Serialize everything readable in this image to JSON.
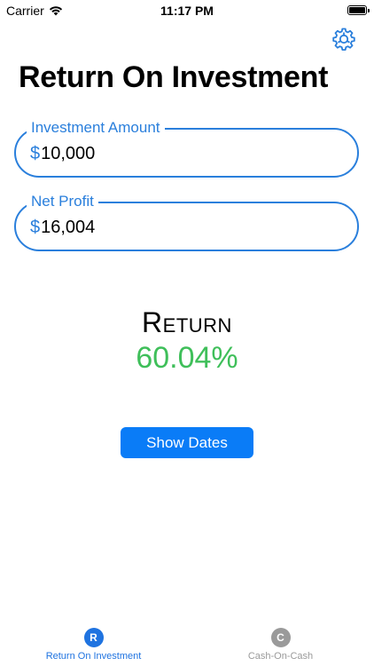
{
  "status_bar": {
    "carrier": "Carrier",
    "time": "11:17 PM"
  },
  "header": {
    "title": "Return On Investment",
    "settings_icon": "gear-icon"
  },
  "fields": {
    "investment_amount": {
      "label": "Investment Amount",
      "currency": "$",
      "value": "10,000"
    },
    "net_profit": {
      "label": "Net Profit",
      "currency": "$",
      "value": "16,004"
    }
  },
  "result": {
    "label": "Return",
    "value": "60.04%"
  },
  "actions": {
    "show_dates_label": "Show Dates"
  },
  "tab_bar": {
    "tabs": [
      {
        "badge": "R",
        "label": "Return On Investment",
        "selected": true
      },
      {
        "badge": "C",
        "label": "Cash-On-Cash",
        "selected": false
      }
    ]
  },
  "colors": {
    "accent": "#2a7fdc",
    "button": "#0a7cf7",
    "positive": "#3fbf5a",
    "tab_inactive": "#9a9a9a"
  }
}
